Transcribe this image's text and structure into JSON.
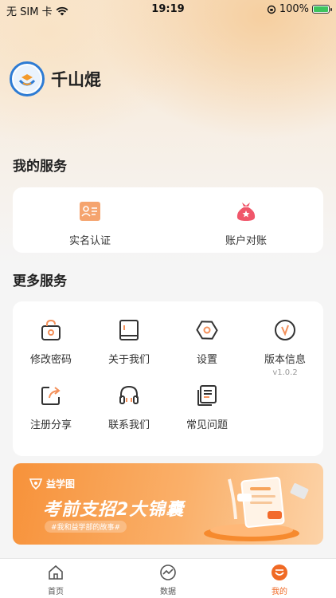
{
  "status_bar": {
    "carrier": "无 SIM 卡",
    "time": "19:19",
    "battery": "100%"
  },
  "profile": {
    "name": "千山焜"
  },
  "my_services": {
    "title": "我的服务",
    "items": [
      {
        "label": "实名认证",
        "icon": "id-card-icon"
      },
      {
        "label": "账户对账",
        "icon": "money-bag-icon"
      }
    ]
  },
  "more_services": {
    "title": "更多服务",
    "items": [
      {
        "label": "修改密码",
        "icon": "lock-icon"
      },
      {
        "label": "关于我们",
        "icon": "book-icon"
      },
      {
        "label": "设置",
        "icon": "hexagon-settings-icon"
      },
      {
        "label": "版本信息",
        "icon": "version-check-icon",
        "sub": "v1.0.2"
      },
      {
        "label": "注册分享",
        "icon": "share-icon"
      },
      {
        "label": "联系我们",
        "icon": "headset-icon"
      },
      {
        "label": "常见问题",
        "icon": "document-list-icon"
      }
    ]
  },
  "banner": {
    "brand": "益学图",
    "title": "考前支招2大锦囊",
    "tag": "#我和益学部的故事#"
  },
  "tabbar": {
    "items": [
      {
        "label": "首页",
        "icon": "home-icon"
      },
      {
        "label": "数据",
        "icon": "chart-trend-icon"
      },
      {
        "label": "我的",
        "icon": "profile-smile-icon",
        "active": true
      }
    ]
  },
  "colors": {
    "accent": "#f06a25",
    "icon_orange": "#f3905a",
    "card_bg": "#ffffff"
  }
}
